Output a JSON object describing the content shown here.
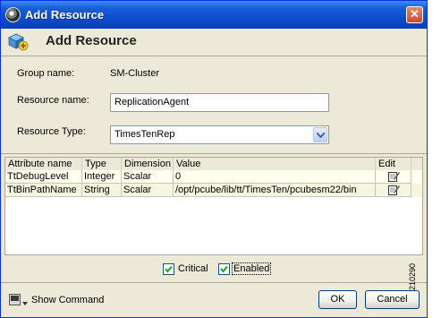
{
  "window": {
    "title": "Add Resource"
  },
  "header": {
    "title": "Add Resource"
  },
  "form": {
    "group_name_label": "Group name:",
    "group_name_value": "SM-Cluster",
    "resource_name_label": "Resource name:",
    "resource_name_value": "ReplicationAgent",
    "resource_type_label": "Resource Type:",
    "resource_type_value": "TimesTenRep"
  },
  "table": {
    "columns": [
      "Attribute name",
      "Type",
      "Dimension",
      "Value",
      "Edit"
    ],
    "rows": [
      {
        "attribute": "TtDebugLevel",
        "type": "Integer",
        "dimension": "Scalar",
        "value": "0"
      },
      {
        "attribute": "TtBinPathName",
        "type": "String",
        "dimension": "Scalar",
        "value": "/opt/pcube/lib/tt/TimesTen/pcubesm22/bin"
      }
    ]
  },
  "options": {
    "critical_label": "Critical",
    "critical_checked": true,
    "enabled_label": "Enabled",
    "enabled_checked": true
  },
  "footer": {
    "show_command_label": "Show Command",
    "ok_label": "OK",
    "cancel_label": "Cancel"
  },
  "figure_id": "210290",
  "icons": [
    "app-icon",
    "close-icon",
    "add-resource-icon",
    "edit-icon",
    "dropdown-arrow-icon",
    "show-command-icon"
  ],
  "colors": {
    "titlebar": "#0b4fd0",
    "dialog_bg": "#ece9d8",
    "input_border": "#7f9db9"
  }
}
